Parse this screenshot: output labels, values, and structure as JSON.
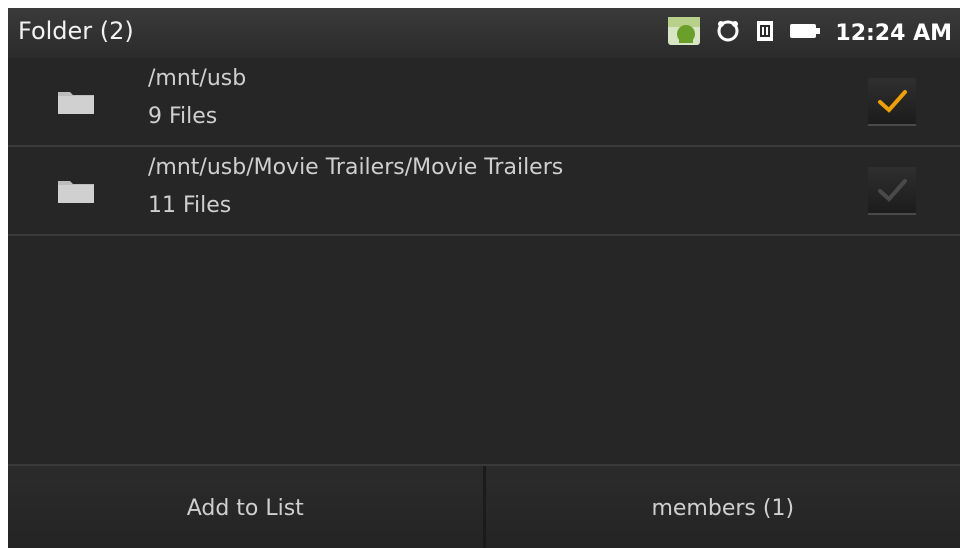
{
  "topbar": {
    "title": "Folder (2)",
    "status_icons": [
      "android-market-icon",
      "sync-icon",
      "sim-card-icon",
      "battery-icon"
    ],
    "time": "12:24 AM"
  },
  "folders": [
    {
      "path": "/mnt/usb",
      "count": "9 Files",
      "checked": true
    },
    {
      "path": "/mnt/usb/Movie Trailers/Movie Trailers",
      "count": "11 Files",
      "checked": false
    }
  ],
  "bottom_buttons": {
    "add_label": "Add to List",
    "members_label": "members  (1)"
  },
  "colors": {
    "check_active": "#f0a000",
    "check_inactive": "#4a4a4a",
    "background": "#262626"
  }
}
